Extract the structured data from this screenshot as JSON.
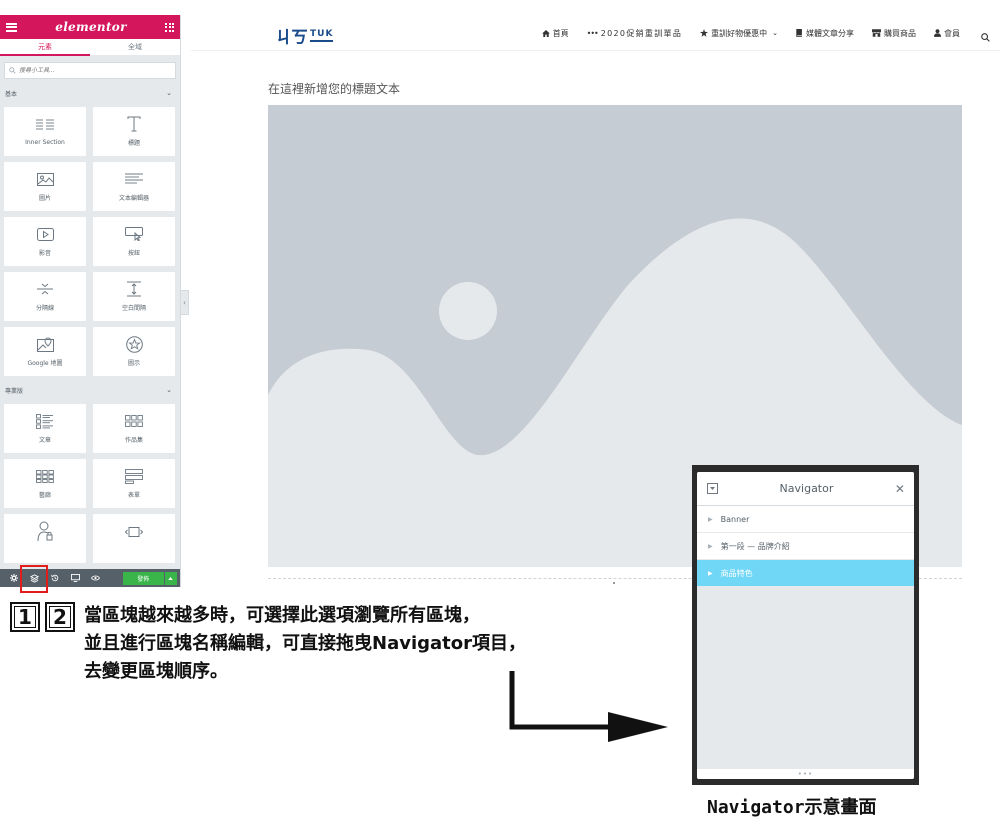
{
  "panel": {
    "logo": "elementor",
    "tabs": [
      "元素",
      "全域"
    ],
    "search_placeholder": "搜尋小工具...",
    "categories": [
      {
        "title": "基本",
        "widgets": [
          {
            "label": "Inner Section",
            "icon": "inner-section-icon"
          },
          {
            "label": "標題",
            "icon": "heading-icon"
          },
          {
            "label": "圖片",
            "icon": "image-icon"
          },
          {
            "label": "文本編輯器",
            "icon": "text-editor-icon"
          },
          {
            "label": "影音",
            "icon": "video-icon"
          },
          {
            "label": "按鈕",
            "icon": "button-icon"
          },
          {
            "label": "分隔線",
            "icon": "divider-icon"
          },
          {
            "label": "空白間隔",
            "icon": "spacer-icon"
          },
          {
            "label": "Google 地圖",
            "icon": "google-maps-icon"
          },
          {
            "label": "圖示",
            "icon": "star-icon"
          }
        ]
      },
      {
        "title": "專業版",
        "widgets": [
          {
            "label": "文章",
            "icon": "posts-icon"
          },
          {
            "label": "作品集",
            "icon": "portfolio-icon"
          },
          {
            "label": "藝廊",
            "icon": "gallery-icon"
          },
          {
            "label": "表單",
            "icon": "form-icon"
          },
          {
            "label": "",
            "icon": "login-icon"
          },
          {
            "label": "",
            "icon": "slides-icon"
          }
        ]
      }
    ],
    "footer": {
      "publish_label": "發佈"
    }
  },
  "site": {
    "brand_mark": "ㄐㄎ",
    "brand_text": "TUK",
    "nav": [
      {
        "label": "首頁",
        "icon": "home-icon"
      },
      {
        "label": "2020促銷重訓單品",
        "icon": "dots-icon"
      },
      {
        "label": "重訓好物優惠中",
        "icon": "star-icon",
        "dropdown": true
      },
      {
        "label": "媒體文章分享",
        "icon": "book-icon"
      },
      {
        "label": "購買商品",
        "icon": "store-icon"
      },
      {
        "label": "會員",
        "icon": "user-icon"
      }
    ]
  },
  "canvas": {
    "heading": "在這裡新增您的標題文本"
  },
  "annotation": {
    "badges": [
      "1",
      "2"
    ],
    "lines": [
      "當區塊越來越多時，可選擇此選項瀏覽所有區塊，",
      "並且進行區塊名稱編輯，可直接拖曳Navigator項目，",
      "去變更區塊順序。"
    ]
  },
  "navigator": {
    "title": "Navigator",
    "items": [
      "Banner",
      "第一段 — 品牌介紹",
      "商品特色"
    ],
    "active_index": 2,
    "footer_glyph": "•••",
    "caption": "Navigator示意畫面"
  },
  "colors": {
    "elementor_brand": "#d4175c",
    "publish_green": "#39b54a",
    "navigator_active": "#71d7f7",
    "placeholder_bg": "#c5ccd3",
    "highlight_red": "#e21b1b"
  }
}
